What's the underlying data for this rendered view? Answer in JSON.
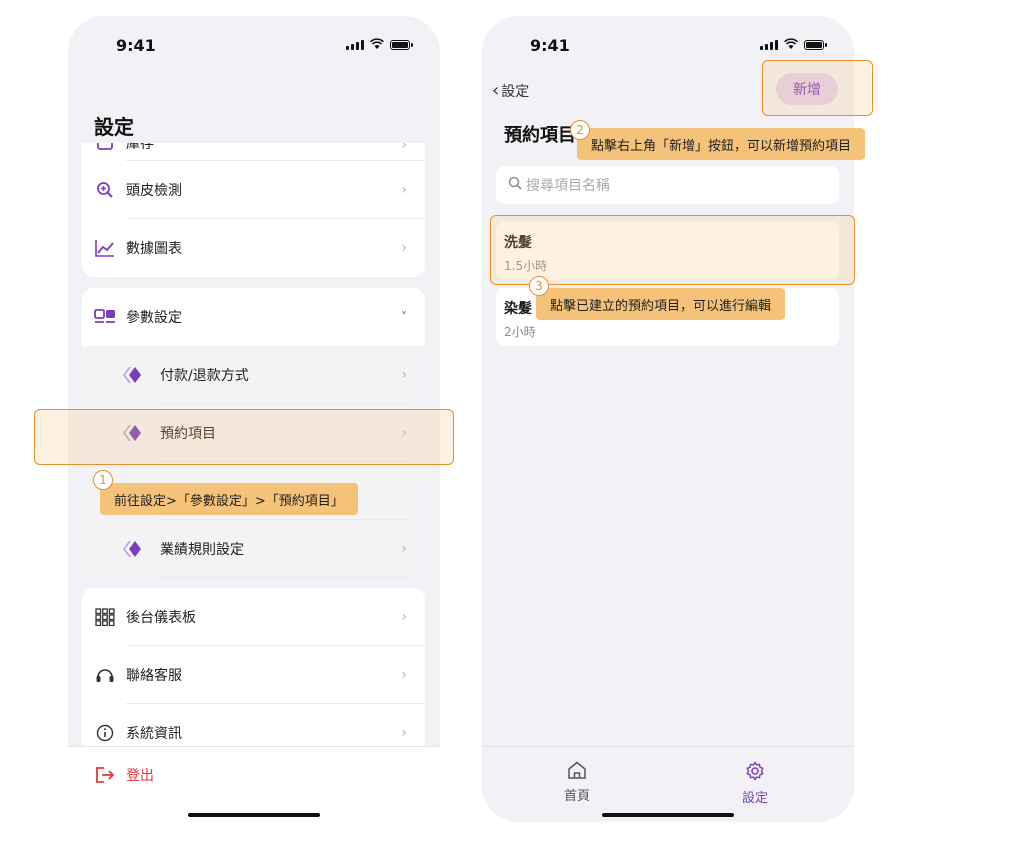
{
  "left_screen": {
    "status_time": "9:41",
    "title": "設定",
    "rows_top": [
      {
        "label": "庫存",
        "icon": "inventory-icon"
      },
      {
        "label": "頭皮檢測",
        "icon": "scalp-magnify-icon"
      },
      {
        "label": "數據圖表",
        "icon": "chart-icon"
      }
    ],
    "params": {
      "label": "參數設定",
      "icon": "params-icon",
      "chevron": "˅"
    },
    "sub_rows": [
      {
        "label": "付款/退款方式"
      },
      {
        "label": "預約項目"
      },
      {
        "label": "業績規則設定"
      }
    ],
    "rows_bottom": [
      {
        "label": "後台儀表板",
        "icon": "dashboard-grid-icon"
      },
      {
        "label": "聯絡客服",
        "icon": "headset-icon"
      },
      {
        "label": "系統資訊",
        "icon": "info-icon"
      }
    ],
    "logout": {
      "label": "登出",
      "icon": "logout-icon",
      "color": "#e53935"
    }
  },
  "right_screen": {
    "status_time": "9:41",
    "back_label": "設定",
    "title": "預約項目",
    "add_button": "新增",
    "search_placeholder": "搜尋項目名稱",
    "services": [
      {
        "name": "洗髮",
        "duration": "1.5小時"
      },
      {
        "name": "染髮",
        "duration": "2小時"
      }
    ],
    "tabs": [
      {
        "label": "首頁",
        "icon": "home-icon"
      },
      {
        "label": "設定",
        "icon": "gear-icon"
      }
    ]
  },
  "annotations": [
    {
      "step": "1",
      "text": "前往設定>「參數設定」>「預約項目」"
    },
    {
      "step": "2",
      "text": "點擊右上角「新增」按鈕，可以新增預約項目"
    },
    {
      "step": "3",
      "text": "點擊已建立的預約項目，可以進行編輯"
    }
  ],
  "colors": {
    "accent": "#7a3fb8",
    "accent_light": "#e3d2f3",
    "annotation": "#f5c27a",
    "annotation_border": "#e8902c"
  }
}
